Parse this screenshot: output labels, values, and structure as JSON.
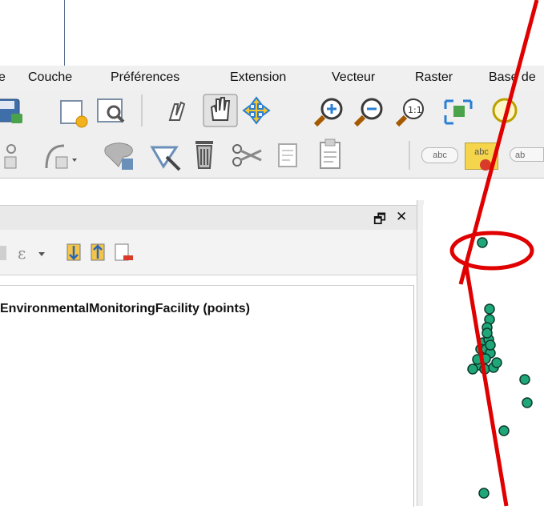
{
  "menubar": {
    "items": [
      {
        "label": "e"
      },
      {
        "label": "Couche"
      },
      {
        "label": "Préférences"
      },
      {
        "label": "Extension"
      },
      {
        "label": "Vecteur"
      },
      {
        "label": "Raster"
      },
      {
        "label": "Base de"
      }
    ]
  },
  "toolbar2": {
    "label_tool_1": "abc",
    "label_tool_2": "abc",
    "label_tool_3": "ab"
  },
  "layers_panel": {
    "float_glyph": "🗗",
    "close_glyph": "✕",
    "layer_name": "EnvironmentalMonitoringFacility (points)"
  },
  "map_canvas": {
    "point_color": "#1fa77a",
    "annotation_color": "#e00000",
    "point_count": 22
  }
}
